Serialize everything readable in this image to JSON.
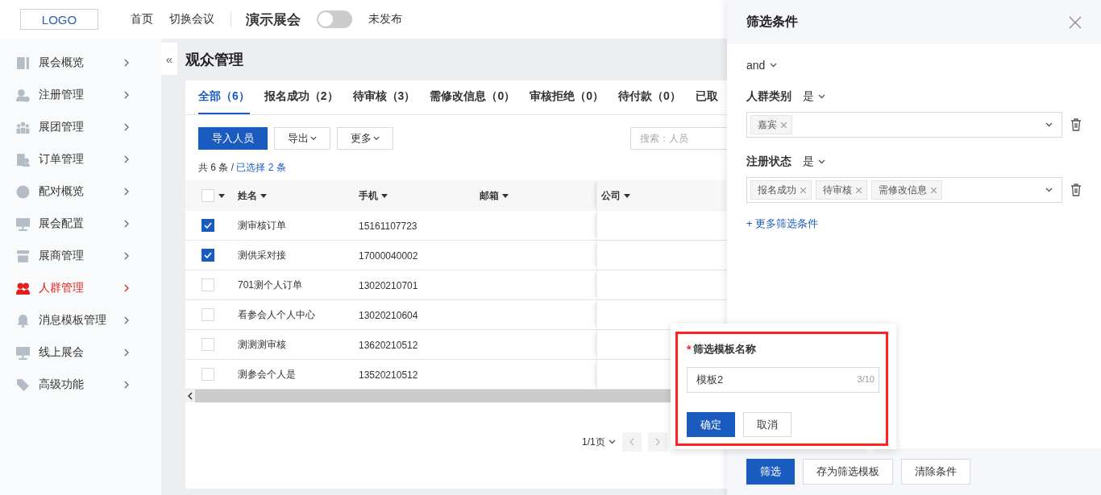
{
  "header": {
    "logo": "LOGO",
    "nav": [
      "首页",
      "切换会议"
    ],
    "event_title": "演示展会",
    "publish_toggle": {
      "on": false
    },
    "publish_status": "未发布"
  },
  "sidebar": {
    "items": [
      {
        "label": "展会概览",
        "selected": false
      },
      {
        "label": "注册管理",
        "selected": false
      },
      {
        "label": "展团管理",
        "selected": false
      },
      {
        "label": "订单管理",
        "selected": false
      },
      {
        "label": "配对概览",
        "selected": false
      },
      {
        "label": "展会配置",
        "selected": false
      },
      {
        "label": "展商管理",
        "selected": false
      },
      {
        "label": "人群管理",
        "selected": true
      },
      {
        "label": "消息模板管理",
        "selected": false
      },
      {
        "label": "线上展会",
        "selected": false
      },
      {
        "label": "高级功能",
        "selected": false
      }
    ]
  },
  "collapse_button": "«",
  "page_title": "观众管理",
  "tabs": [
    {
      "label": "全部（6）",
      "selected": true
    },
    {
      "label": "报名成功（2）",
      "selected": false
    },
    {
      "label": "待审核（3）",
      "selected": false
    },
    {
      "label": "需修改信息（0）",
      "selected": false
    },
    {
      "label": "审核拒绝（0）",
      "selected": false
    },
    {
      "label": "待付款（0）",
      "selected": false
    },
    {
      "label": "已取",
      "selected": false
    }
  ],
  "toolbar": {
    "buttons": [
      {
        "label": "导入人员",
        "kind": "primary"
      },
      {
        "label": "导出",
        "kind": "dropdown"
      },
      {
        "label": "更多",
        "kind": "dropdown"
      }
    ],
    "search": {
      "placeholder": "搜索：人员"
    }
  },
  "summary": {
    "total": "共 6 条 / ",
    "selected": "已选择 2 条"
  },
  "table": {
    "header_checked": false,
    "columns": [
      "姓名",
      "手机",
      "邮箱",
      "公司"
    ],
    "rows": [
      {
        "selected": true,
        "cells": [
          "测审核订单",
          "15161107723"
        ]
      },
      {
        "selected": true,
        "cells": [
          "测供采对接",
          "17000040002"
        ]
      },
      {
        "selected": false,
        "cells": [
          "701测个人订单",
          "13020210701"
        ]
      },
      {
        "selected": false,
        "cells": [
          "看参会人个人中心",
          "13020210604"
        ]
      },
      {
        "selected": false,
        "cells": [
          "测测测审核",
          "13620210512"
        ]
      },
      {
        "selected": false,
        "cells": [
          "测参会个人是",
          "13520210512"
        ]
      }
    ]
  },
  "pagination": {
    "page": "1/1页"
  },
  "drawer": {
    "title": "筛选条件",
    "logic": "and",
    "filters": [
      {
        "field": "人群类别",
        "operator": "是",
        "tags": [
          "嘉宾"
        ]
      },
      {
        "field": "注册状态",
        "operator": "是",
        "tags": [
          "报名成功",
          "待审核",
          "需修改信息"
        ]
      }
    ],
    "add_filter": "+ 更多筛选条件",
    "footer_buttons": [
      {
        "label": "筛选",
        "kind": "primary"
      },
      {
        "label": "存为筛选模板",
        "kind": "default"
      },
      {
        "label": "清除条件",
        "kind": "default"
      }
    ]
  },
  "template_popover": {
    "required_mark": "*",
    "label": "筛选模板名称",
    "value": "模板2",
    "counter": "3/10",
    "buttons": [
      {
        "label": "确定",
        "kind": "primary"
      },
      {
        "label": "取消",
        "kind": "default"
      }
    ]
  }
}
